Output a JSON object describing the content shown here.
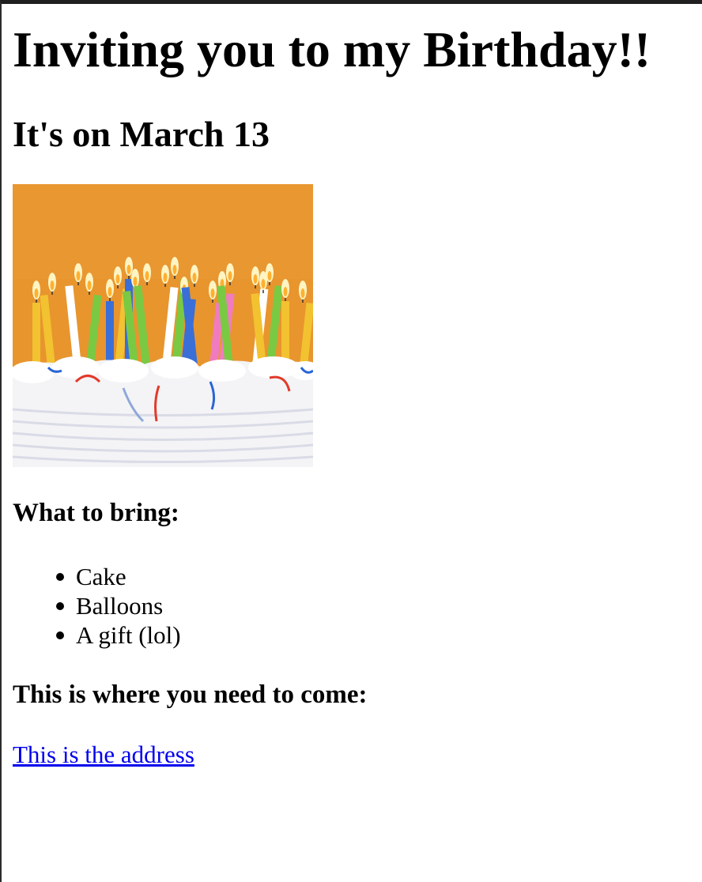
{
  "page": {
    "title": "Inviting you to my Birthday!!",
    "date_heading": "It's on March 13",
    "bring_heading": "What to bring:",
    "bring_items": [
      "Cake",
      "Balloons",
      "A gift (lol)"
    ],
    "where_heading": "This is where you need to come:",
    "address_link": "This is the address"
  },
  "image": {
    "subject": "birthday-cake-with-candles",
    "background_color": "#e8952e",
    "frosting_color": "#f4f4f6",
    "candle_colors": [
      "#f2c230",
      "#3a6fd8",
      "#7ac943",
      "#ffffff",
      "#f07cbf"
    ]
  },
  "colors": {
    "link": "#0000ee",
    "text": "#000000",
    "background": "#ffffff"
  }
}
